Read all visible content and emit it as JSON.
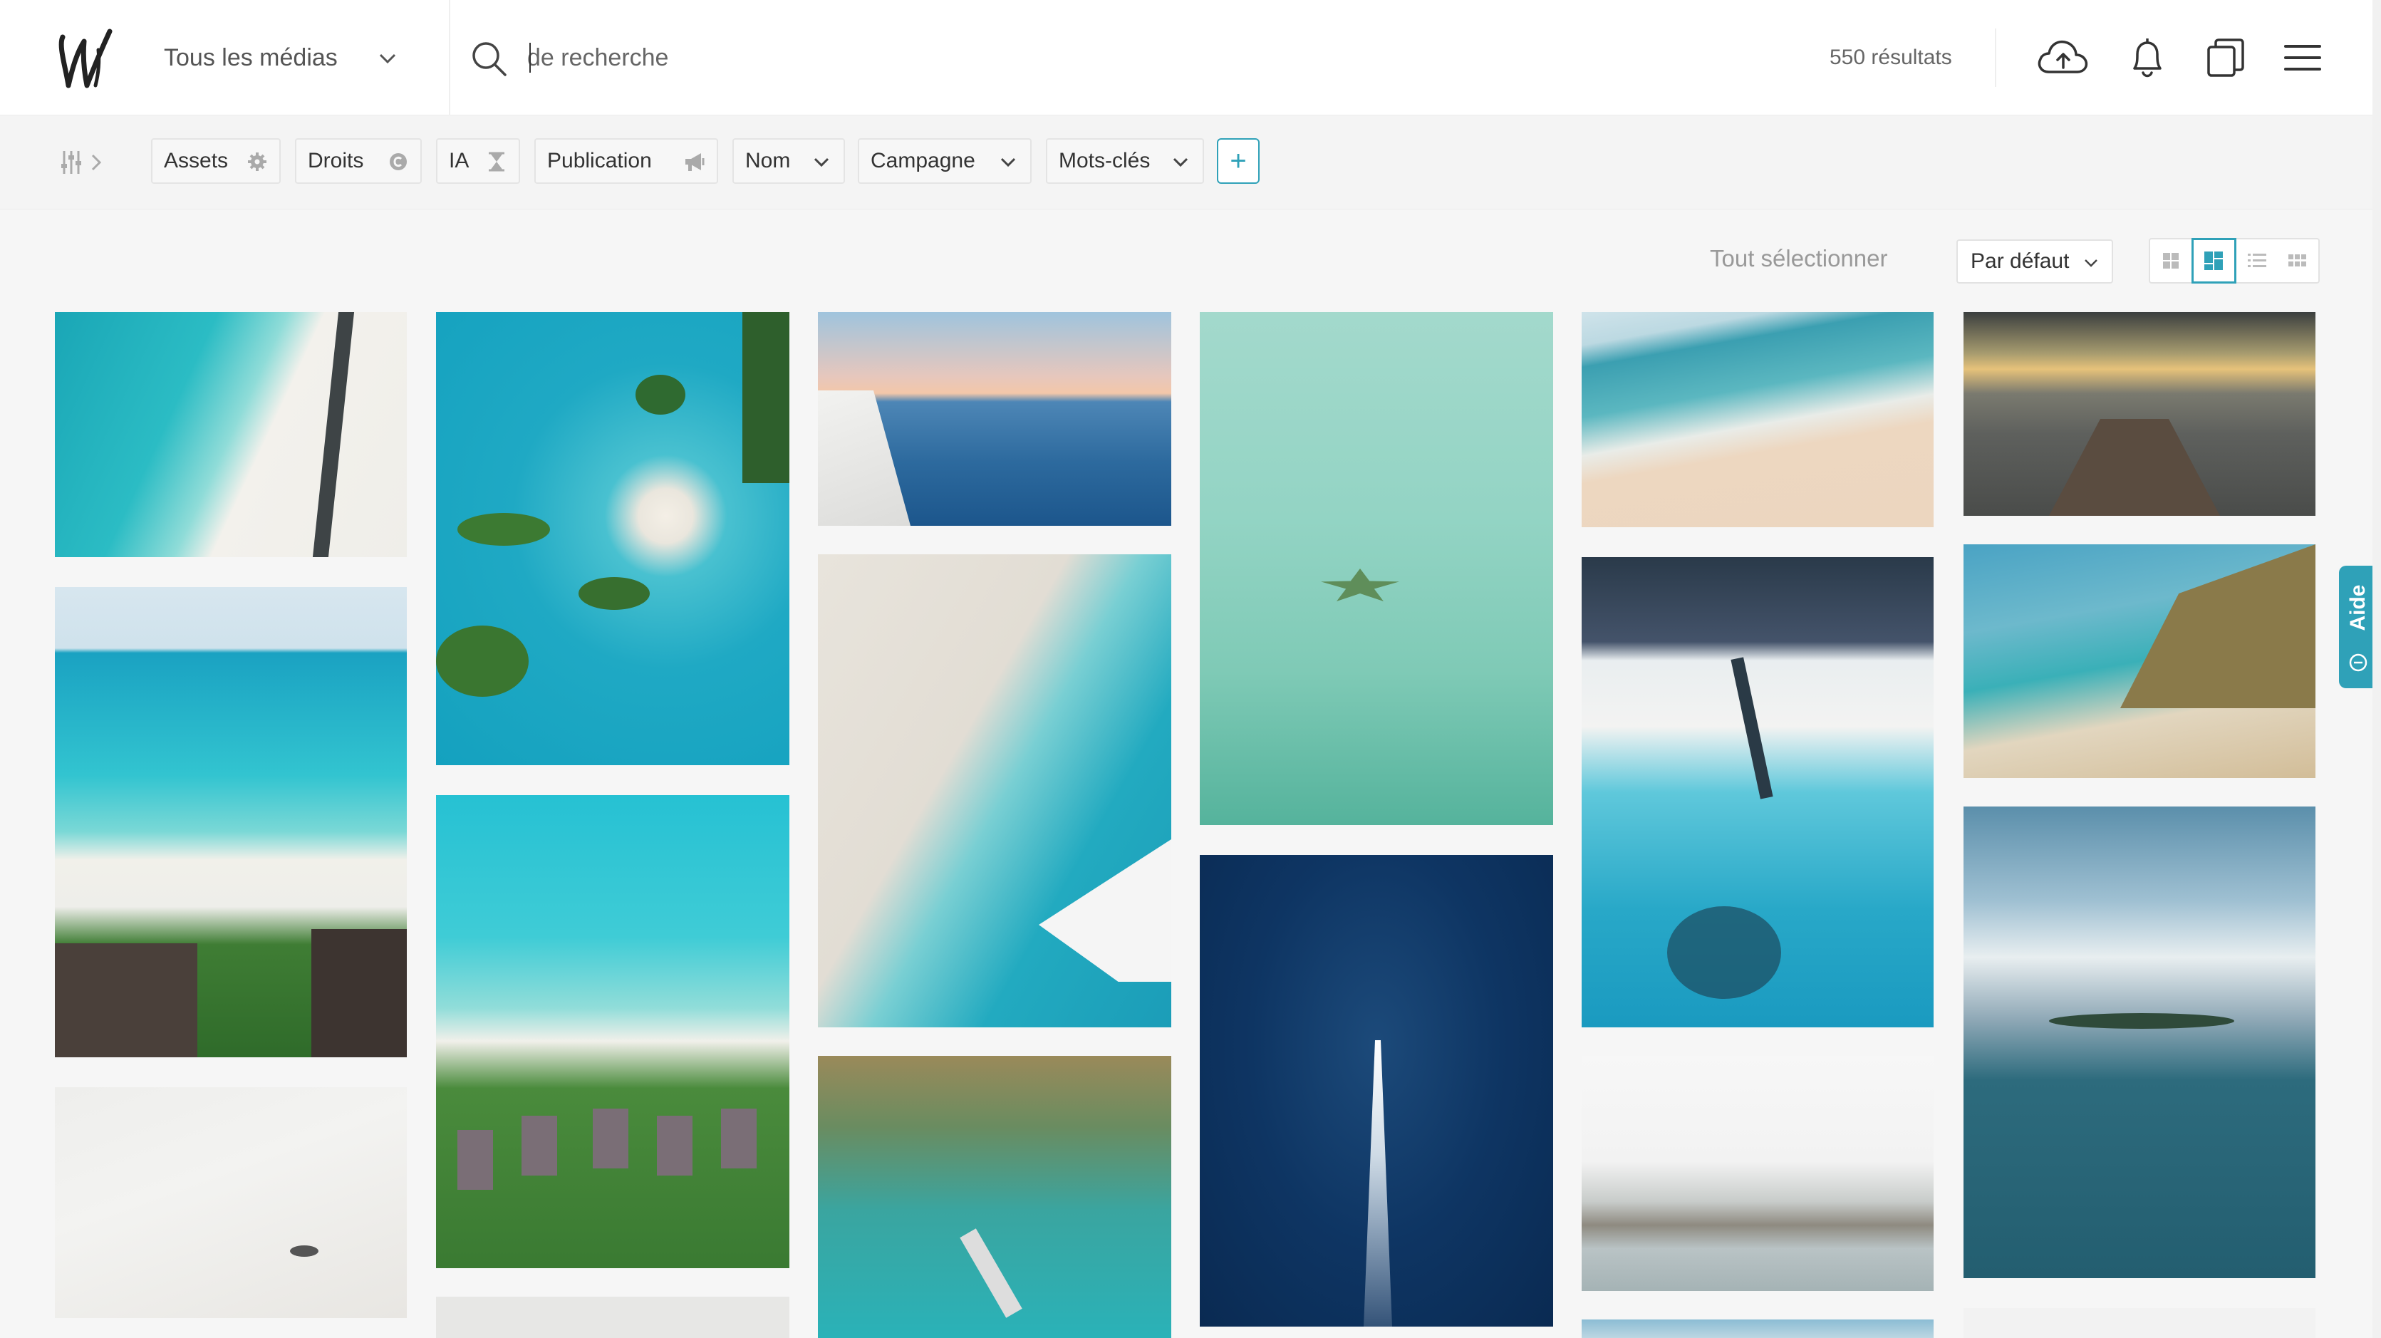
{
  "header": {
    "media_filter": "Tous les médias",
    "search_placeholder": "de recherche",
    "results_count": "550 résultats"
  },
  "filters": {
    "chips": [
      {
        "label": "Assets",
        "icon": "gear-icon"
      },
      {
        "label": "Droits",
        "icon": "copyright-icon"
      },
      {
        "label": "IA",
        "icon": "hourglass-icon"
      },
      {
        "label": "Publication",
        "icon": "megaphone-icon"
      },
      {
        "label": "Nom",
        "icon": "chevron-down-icon"
      },
      {
        "label": "Campagne",
        "icon": "chevron-down-icon"
      },
      {
        "label": "Mots-clés",
        "icon": "chevron-down-icon"
      }
    ],
    "add_label": "+"
  },
  "toolbar": {
    "select_all": "Tout sélectionner",
    "sort_value": "Par défaut",
    "view_modes": [
      "grid-small-icon",
      "masonry-icon",
      "list-icon",
      "grid-dense-icon"
    ],
    "active_view": "masonry-icon"
  },
  "help": {
    "label": "Aide"
  },
  "colors": {
    "accent": "#2fa1b8",
    "header_bg": "#ffffff",
    "page_bg": "#f6f6f6"
  }
}
